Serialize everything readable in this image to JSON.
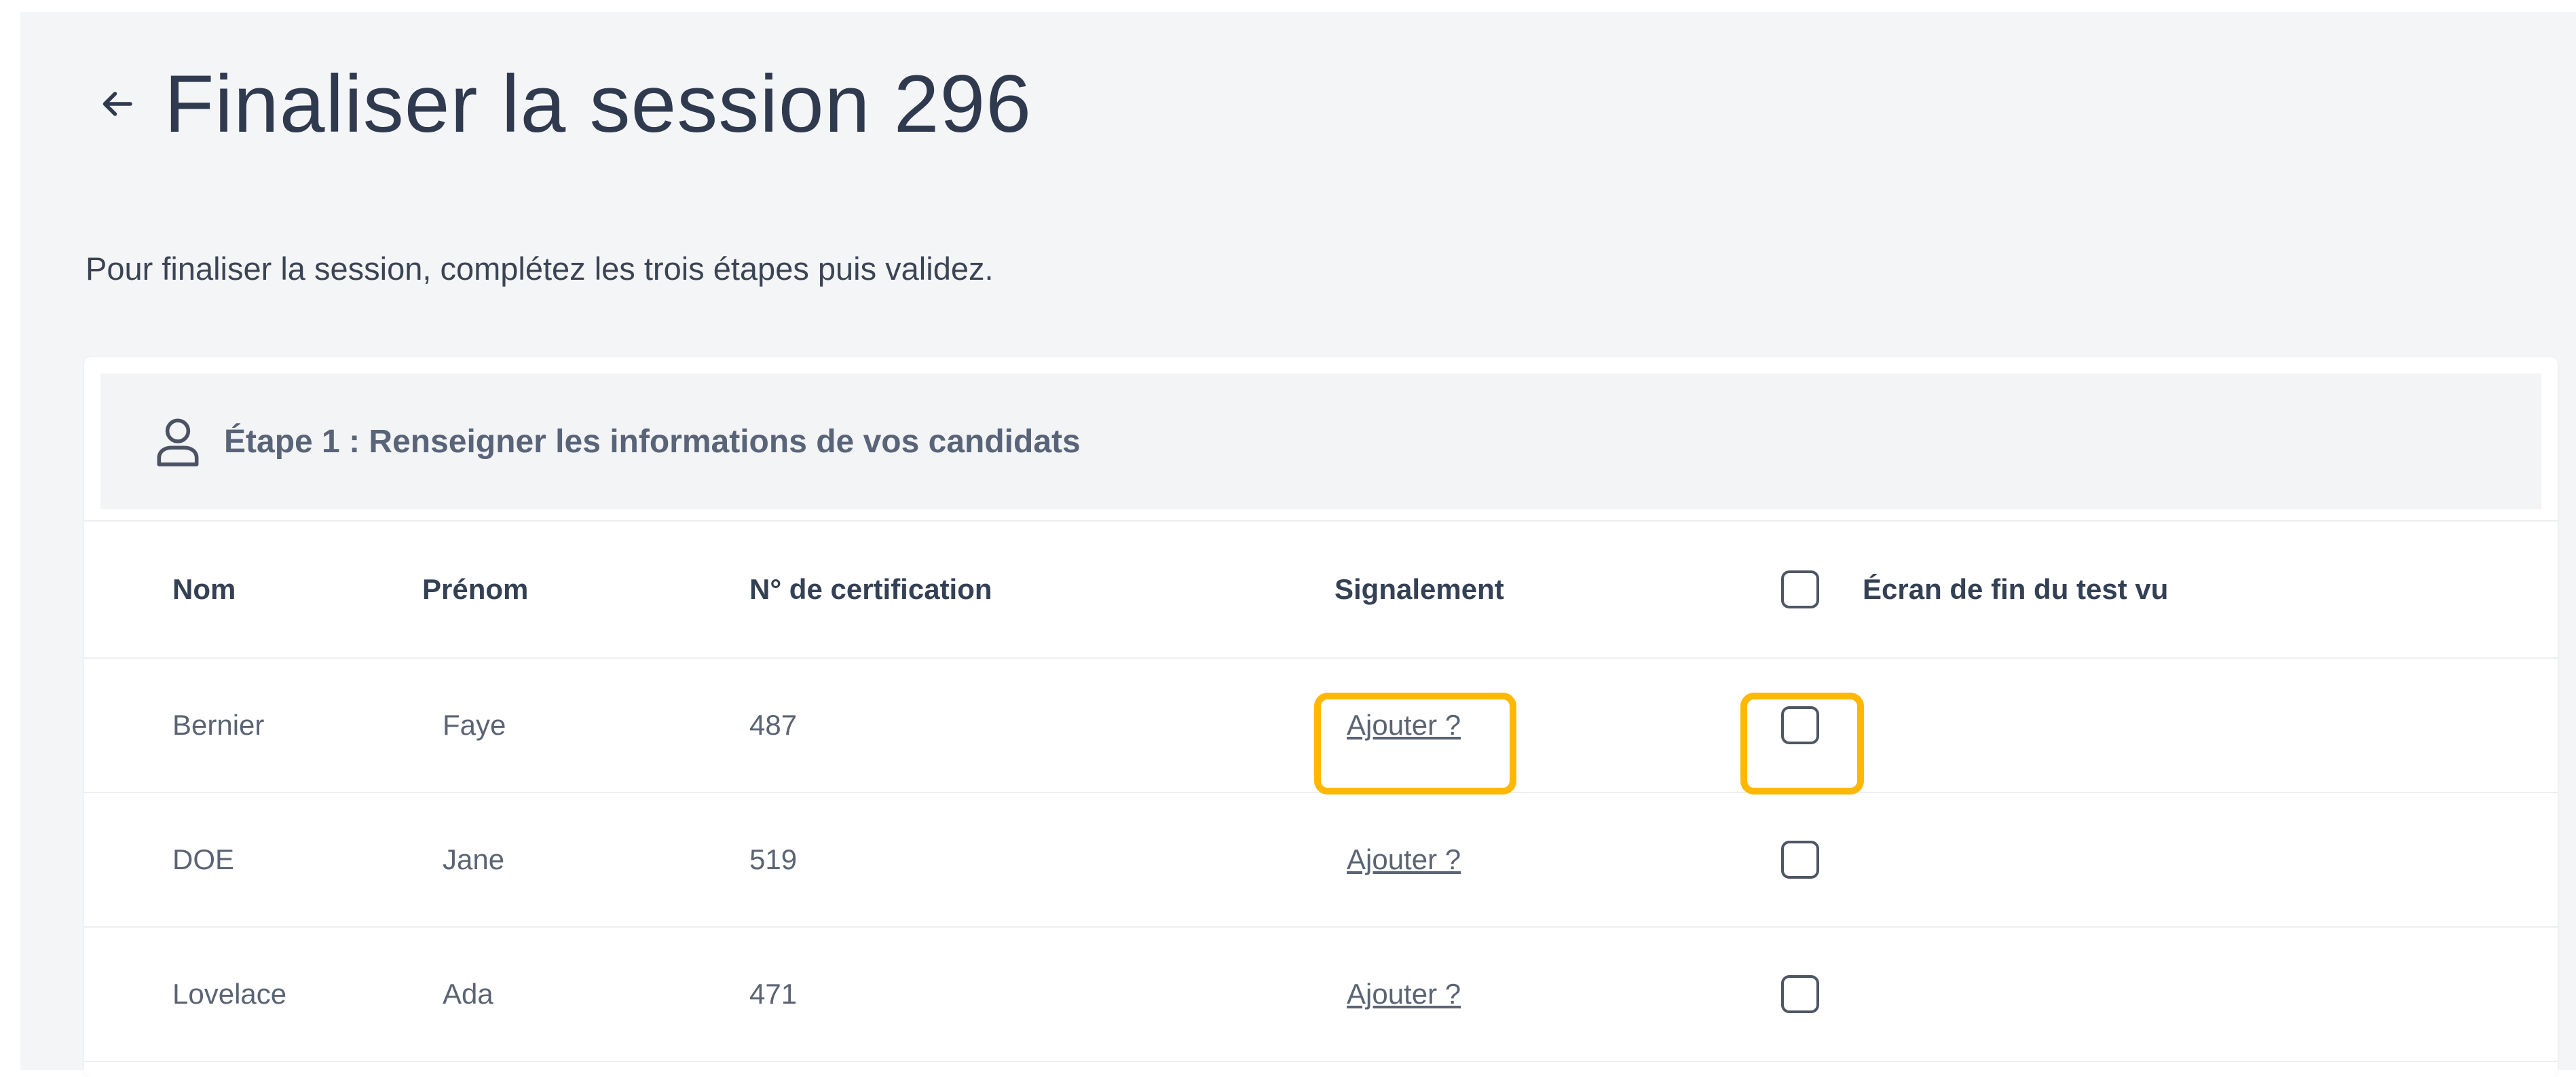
{
  "page": {
    "title": "Finaliser la session 296",
    "intro": "Pour finaliser la session, complétez les trois étapes puis validez."
  },
  "step1": {
    "title": "Étape 1 : Renseigner les informations de vos candidats"
  },
  "table": {
    "columns": {
      "nom": "Nom",
      "prenom": "Prénom",
      "certification": "N° de certification",
      "signalement": "Signalement",
      "ecran_fin": "Écran de fin du test vu"
    },
    "rows": [
      {
        "nom": "Bernier",
        "prenom": "Faye",
        "certification": "487",
        "signalement": "Ajouter ?",
        "checked": false
      },
      {
        "nom": "DOE",
        "prenom": "Jane",
        "certification": "519",
        "signalement": "Ajouter ?",
        "checked": false
      },
      {
        "nom": "Lovelace",
        "prenom": "Ada",
        "certification": "471",
        "signalement": "Ajouter ?",
        "checked": false
      }
    ]
  },
  "icons": {
    "back": "arrow-left-icon",
    "step": "user-icon"
  },
  "colors": {
    "highlight": "#ffb800",
    "background": "#f4f5f7",
    "title": "#2f3a4f"
  }
}
